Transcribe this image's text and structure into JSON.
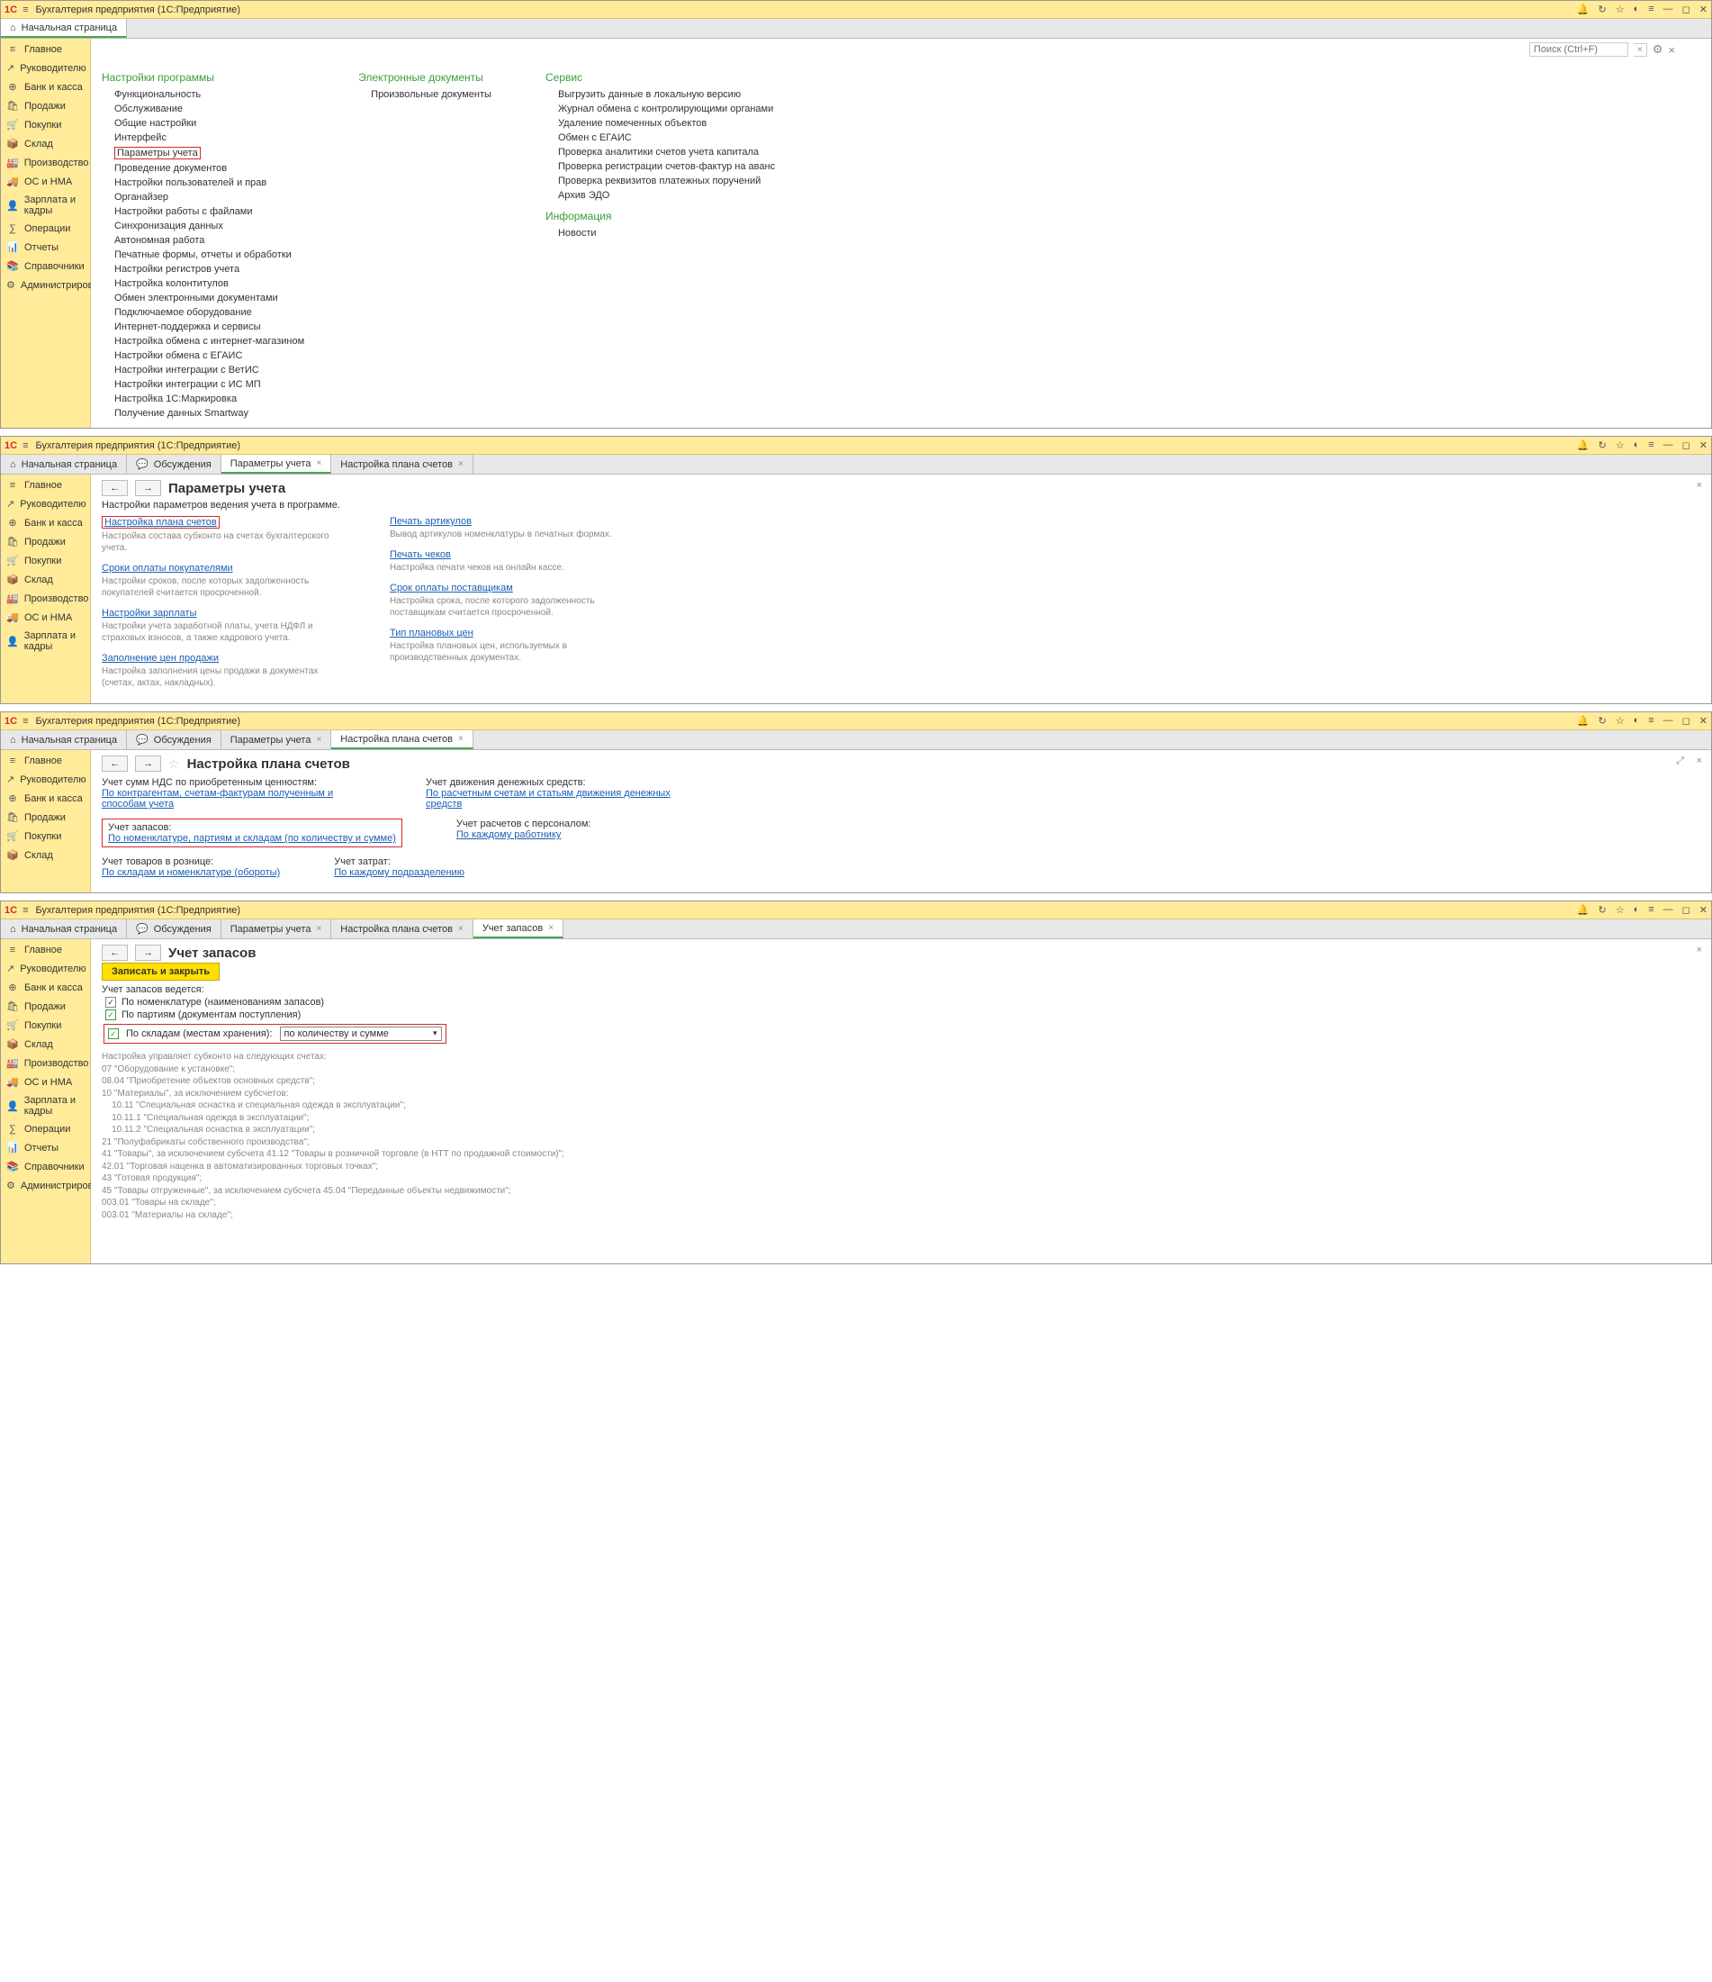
{
  "common": {
    "app_title": "Бухгалтерия предприятия  (1С:Предприятие)",
    "logo_text": "1С",
    "home_tab": "Начальная страница",
    "discussions_tab": "Обсуждения",
    "sidebar": [
      {
        "icon": "≡",
        "label": "Главное"
      },
      {
        "icon": "↗",
        "label": "Руководителю"
      },
      {
        "icon": "⊕",
        "label": "Банк и касса"
      },
      {
        "icon": "🛍",
        "label": "Продажи"
      },
      {
        "icon": "🛒",
        "label": "Покупки"
      },
      {
        "icon": "📦",
        "label": "Склад"
      },
      {
        "icon": "🏭",
        "label": "Производство"
      },
      {
        "icon": "🚚",
        "label": "ОС и НМА"
      },
      {
        "icon": "👤",
        "label": "Зарплата и кадры"
      },
      {
        "icon": "∑",
        "label": "Операции"
      },
      {
        "icon": "📊",
        "label": "Отчеты"
      },
      {
        "icon": "📚",
        "label": "Справочники"
      },
      {
        "icon": "⚙",
        "label": "Администрирование"
      }
    ],
    "win_icons": [
      "🔔",
      "↻",
      "☆",
      "◐",
      "≡",
      "—",
      "◻",
      "✕"
    ]
  },
  "s1": {
    "search_placeholder": "Поиск (Ctrl+F)",
    "col1_title": "Настройки программы",
    "col1_items": [
      "Функциональность",
      "Обслуживание",
      "Общие настройки",
      "Интерфейс",
      "Параметры учета",
      "Проведение документов",
      "Настройки пользователей и прав",
      "Органайзер",
      "Настройки работы с файлами",
      "Синхронизация данных",
      "Автономная работа",
      "Печатные формы, отчеты и обработки",
      "Настройки регистров учета",
      "Настройка колонтитулов",
      "Обмен электронными документами",
      "Подключаемое оборудование",
      "Интернет-поддержка и сервисы",
      "Настройка обмена с интернет-магазином",
      "Настройки обмена с ЕГАИС",
      "Настройки интеграции с ВетИС",
      "Настройки интеграции с ИС МП",
      "Настройка 1С:Маркировка",
      "Получение данных Smartway"
    ],
    "col2_title": "Электронные документы",
    "col2_items": [
      "Произвольные документы"
    ],
    "col3_title": "Сервис",
    "col3_items": [
      "Выгрузить данные в локальную версию",
      "Журнал обмена с контролирующими органами",
      "Удаление помеченных объектов",
      "Обмен с ЕГАИС",
      "Проверка аналитики счетов учета капитала",
      "Проверка регистрации счетов-фактур на аванс",
      "Проверка реквизитов платежных поручений",
      "Архив ЭДО"
    ],
    "col4_title": "Информация",
    "col4_items": [
      "Новости"
    ]
  },
  "s2": {
    "tab_params": "Параметры учета",
    "tab_plan": "Настройка плана счетов",
    "page_title": "Параметры учета",
    "subtitle": "Настройки параметров ведения учета в программе.",
    "left": [
      {
        "link": "Настройка плана счетов",
        "note": "Настройка состава субконто на счетах бухгалтерского учета.",
        "red": true
      },
      {
        "link": "Сроки оплаты покупателями",
        "note": "Настройки сроков, после которых задолженность покупателей считается просроченной."
      },
      {
        "link": "Настройки зарплаты",
        "note": "Настройки учета заработной платы, учета НДФЛ и страховых взносов, а также кадрового учета."
      },
      {
        "link": "Заполнение цен продажи",
        "note": "Настройка заполнения цены продажи в документах (счетах, актах, накладных)."
      }
    ],
    "right": [
      {
        "link": "Печать артикулов",
        "note": "Вывод артикулов номенклатуры в печатных формах."
      },
      {
        "link": "Печать чеков",
        "note": "Настройка печати чеков на онлайн кассе."
      },
      {
        "link": "Срок оплаты поставщикам",
        "note": "Настройка срока, после которого задолженность поставщикам считается просроченной."
      },
      {
        "link": "Тип плановых цен",
        "note": "Настройка плановых цен, используемых в производственных документах."
      }
    ]
  },
  "s3": {
    "page_title": "Настройка плана счетов",
    "rows": [
      {
        "l_label": "Учет сумм НДС по приобретенным ценностям:",
        "l_link": "По контрагентам, счетам-фактурам полученным и способам учета",
        "r_label": "Учет движения денежных средств:",
        "r_link": "По расчетным счетам и статьям движения денежных средств"
      },
      {
        "l_label": "Учет запасов:",
        "l_link": "По номенклатуре, партиям и складам (по количеству и сумме)",
        "r_label": "Учет расчетов с персоналом:",
        "r_link": "По каждому работнику",
        "red": true
      },
      {
        "l_label": "Учет товаров в рознице:",
        "l_link": "По складам и номенклатуре (обороты)",
        "r_label": "Учет затрат:",
        "r_link": "По каждому подразделению"
      }
    ]
  },
  "s4": {
    "tab_stock": "Учет запасов",
    "page_title": "Учет запасов",
    "save_btn": "Записать и закрыть",
    "header": "Учет запасов ведется:",
    "chk1": "По номенклатуре (наименованиям запасов)",
    "chk2": "По партиям (документам поступления)",
    "chk3": "По складам (местам хранения):",
    "dd_value": "по количеству и сумме",
    "info": "Настройка управляет субконто на следующих счетах:\n07 \"Оборудование к установке\";\n08.04 \"Приобретение объектов основных средств\";\n10 \"Материалы\", за исключением субсчетов:\n    10.11 \"Специальная оснастка и специальная одежда в эксплуатации\";\n    10.11.1 \"Специальная одежда в эксплуатации\";\n    10.11.2 \"Специальная оснастка в эксплуатации\";\n21 \"Полуфабрикаты собственного производства\";\n41 \"Товары\", за исключением субсчета 41.12 \"Товары в розничной торговле (в НТТ по продажной стоимости)\";\n42.01 \"Торговая наценка в автоматизированных торговых точках\";\n43 \"Готовая продукция\";\n45 \"Товары отгруженные\", за исключением субсчета 45.04 \"Переданные объекты недвижимости\";\n003.01 \"Товары на складе\";\n003.01 \"Материалы на складе\";"
  }
}
